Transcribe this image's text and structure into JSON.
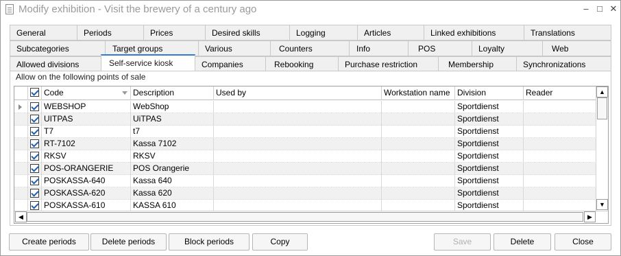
{
  "window": {
    "title": "Modify exhibition - Visit the brewery of a century ago",
    "minimize_symbol": "–",
    "maximize_symbol": "□",
    "close_symbol": "✕"
  },
  "tabs": {
    "row1": [
      "General",
      "Periods",
      "Prices",
      "Desired skills",
      "Logging",
      "Articles",
      "Linked exhibitions",
      "Translations"
    ],
    "row2": [
      "Subcategories",
      "Target groups",
      "Various",
      "Counters",
      "Info",
      "POS",
      "Loyalty",
      "Web"
    ],
    "row3": [
      "Allowed divisions",
      "Self-service kiosk",
      "Companies",
      "Rebooking",
      "Purchase restriction",
      "Membership",
      "Synchronizations"
    ],
    "active": "Self-service kiosk"
  },
  "panel": {
    "caption": "Allow on the following points of sale"
  },
  "grid": {
    "columns": [
      "Code",
      "Description",
      "Used by",
      "Workstation name",
      "Division",
      "Reader"
    ],
    "header_checked": true,
    "rows": [
      {
        "checked": true,
        "code": "WEBSHOP",
        "description": "WebShop",
        "used_by": "",
        "workstation": "",
        "division": "Sportdienst",
        "reader": ""
      },
      {
        "checked": true,
        "code": "UITPAS",
        "description": "UiTPAS",
        "used_by": "",
        "workstation": "",
        "division": "Sportdienst",
        "reader": ""
      },
      {
        "checked": true,
        "code": "T7",
        "description": "t7",
        "used_by": "",
        "workstation": "",
        "division": "Sportdienst",
        "reader": ""
      },
      {
        "checked": true,
        "code": "RT-7102",
        "description": "Kassa 7102",
        "used_by": "",
        "workstation": "",
        "division": "Sportdienst",
        "reader": ""
      },
      {
        "checked": true,
        "code": "RKSV",
        "description": "RKSV",
        "used_by": "",
        "workstation": "",
        "division": "Sportdienst",
        "reader": ""
      },
      {
        "checked": true,
        "code": "POS-ORANGERIE",
        "description": "POS Orangerie",
        "used_by": "",
        "workstation": "",
        "division": "Sportdienst",
        "reader": ""
      },
      {
        "checked": true,
        "code": "POSKASSA-640",
        "description": "Kassa 640",
        "used_by": "",
        "workstation": "",
        "division": "Sportdienst",
        "reader": ""
      },
      {
        "checked": true,
        "code": "POSKASSA-620",
        "description": "Kassa 620",
        "used_by": "",
        "workstation": "",
        "division": "Sportdienst",
        "reader": ""
      },
      {
        "checked": true,
        "code": "POSKASSA-610",
        "description": "KASSA 610",
        "used_by": "",
        "workstation": "",
        "division": "Sportdienst",
        "reader": ""
      }
    ]
  },
  "buttons": {
    "create_periods": "Create periods",
    "delete_periods": "Delete periods",
    "block_periods": "Block periods",
    "copy": "Copy",
    "save": "Save",
    "delete": "Delete",
    "close": "Close"
  },
  "scroll": {
    "up": "▲",
    "down": "▼",
    "left": "◀",
    "right": "▶"
  }
}
